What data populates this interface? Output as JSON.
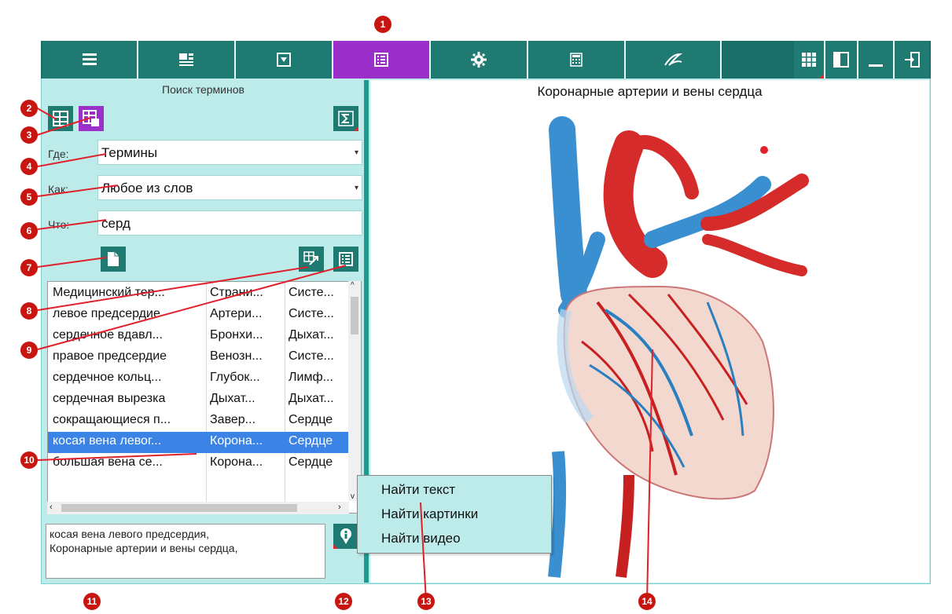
{
  "toolbar": {
    "buttons": [
      {
        "name": "list-icon",
        "active": false
      },
      {
        "name": "layout-icon",
        "active": false
      },
      {
        "name": "dropdown-box-icon",
        "active": false
      },
      {
        "name": "term-list-icon",
        "active": true
      },
      {
        "name": "gear-icon",
        "active": false
      },
      {
        "name": "calculator-icon",
        "active": false
      },
      {
        "name": "pen-icon",
        "active": false
      }
    ],
    "right_buttons": [
      "grid-icon",
      "panel-icon",
      "minimize-icon",
      "exit-icon"
    ]
  },
  "search": {
    "title": "Поиск терминов",
    "where_label": "Где:",
    "where_value": "Термины",
    "how_label": "Как:",
    "how_value": "Любое из слов",
    "what_label": "Что:",
    "what_value": "серд"
  },
  "table": {
    "rows": [
      [
        "Медицинский тер...",
        "Страни...",
        "Систе..."
      ],
      [
        "левое предсердие",
        "Артери...",
        "Систе..."
      ],
      [
        "сердечное вдавл...",
        "Бронхи...",
        "Дыхат..."
      ],
      [
        "правое предсердие",
        "Венозн...",
        "Систе..."
      ],
      [
        "сердечное кольц...",
        "Глубок...",
        "Лимф..."
      ],
      [
        "сердечная вырезка",
        "Дыхат...",
        "Дыхат..."
      ],
      [
        "сокращающиеся п...",
        "Завер...",
        "Сердце"
      ],
      [
        "косая вена левог...",
        "Корона...",
        "Сердце"
      ],
      [
        "большая вена се...",
        "Корона...",
        "Сердце"
      ]
    ],
    "selected_row": 7
  },
  "info_text": {
    "line1": "косая вена левого предсердия,",
    "line2": "Коронарные артерии и вены сердца,"
  },
  "image_title": "Коронарные артерии и вены сердца",
  "context_menu": {
    "items": [
      "Найти текст",
      "Найти картинки",
      "Найти видео"
    ]
  },
  "callouts": [
    "1",
    "2",
    "3",
    "4",
    "5",
    "6",
    "7",
    "8",
    "9",
    "10",
    "11",
    "12",
    "13",
    "14"
  ],
  "colors": {
    "toolbar": "#1f7a72",
    "active": "#9b2fc9",
    "panel": "#bdebea",
    "selection": "#3b84e6",
    "callout": "#c8150f"
  }
}
